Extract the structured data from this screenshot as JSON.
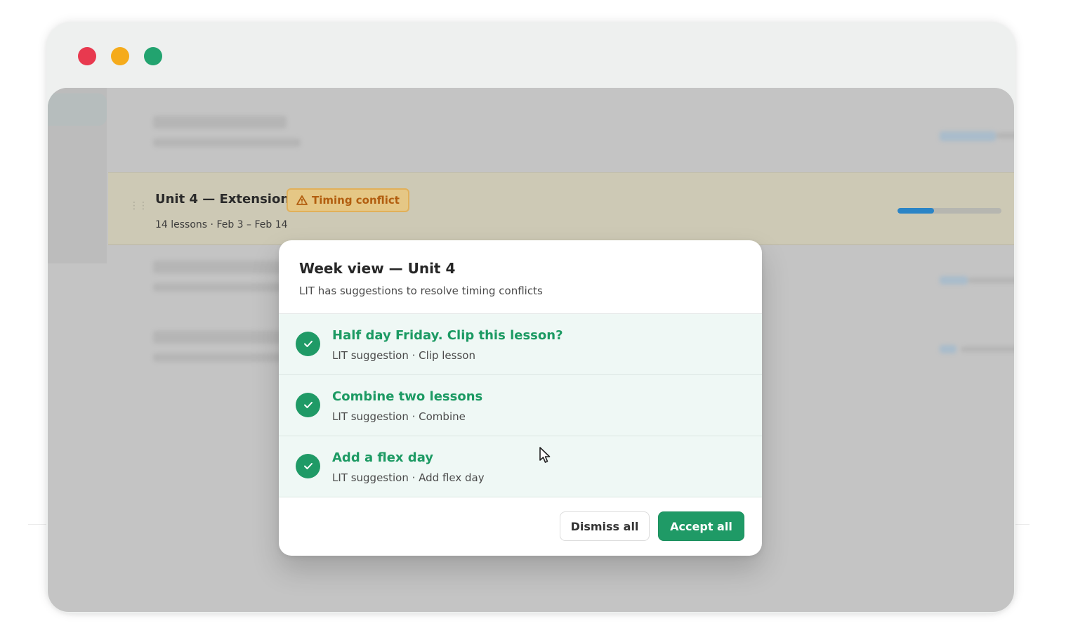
{
  "window": {
    "colors": {
      "close": "#e8394f",
      "minimize": "#f5ab1b",
      "maximize": "#22a36f"
    }
  },
  "unit_row": {
    "title": "Unit 4 — Extension",
    "badge_label": "Timing conflict",
    "badge_icon": "warning-triangle-icon",
    "meta": "14 lessons · Feb 3 – Feb 14",
    "progress_fraction": 0.35
  },
  "modal": {
    "title": "Week view — Unit 4",
    "subtitle": "LIT has suggestions to resolve timing conflicts",
    "suggestions": [
      {
        "title": "Half day Friday. Clip this lesson?",
        "meta": "LIT suggestion · Clip lesson",
        "icon": "check-icon"
      },
      {
        "title": "Combine two lessons",
        "meta": "LIT suggestion · Combine",
        "icon": "check-icon"
      },
      {
        "title": "Add a flex day",
        "meta": "LIT suggestion · Add flex day",
        "icon": "check-icon"
      }
    ],
    "dismiss_label": "Dismiss all",
    "accept_label": "Accept all"
  },
  "colors": {
    "accent_green": "#1f9a66",
    "warning_orange": "#b25e0f",
    "progress_blue": "#2a84c6"
  }
}
